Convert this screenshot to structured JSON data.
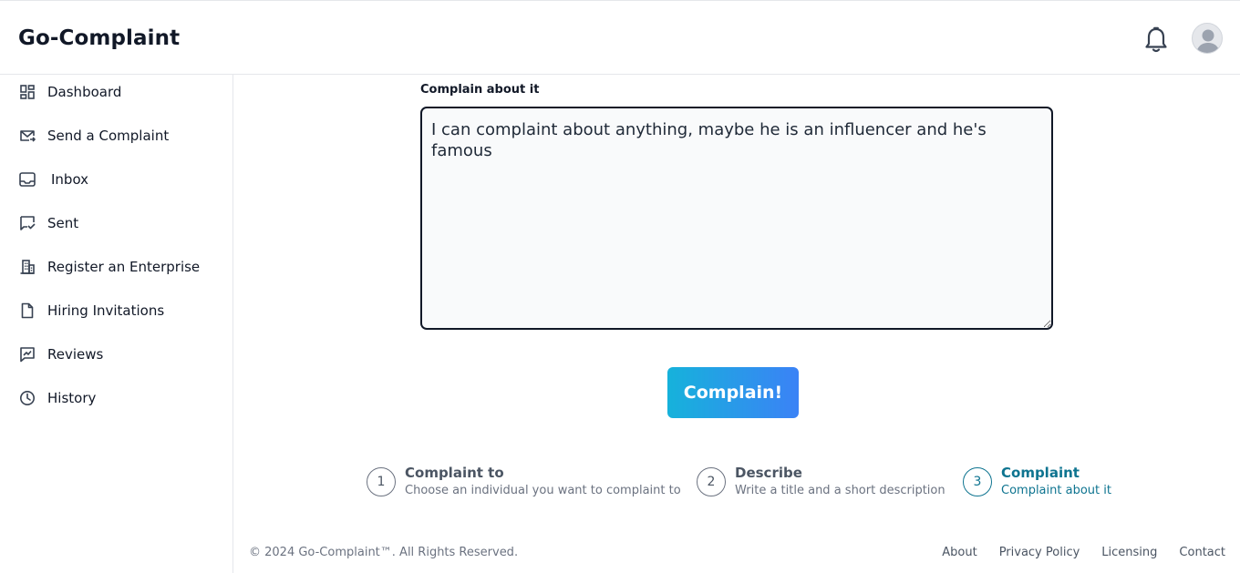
{
  "header": {
    "brand": "Go-Complaint",
    "notifications_icon": "bell-icon",
    "avatar_icon": "user-avatar-icon"
  },
  "sidebar": {
    "items": [
      {
        "label": "Dashboard",
        "icon": "dashboard-icon"
      },
      {
        "label": "Send a Complaint",
        "icon": "mail-send-icon"
      },
      {
        "label": "Inbox",
        "icon": "inbox-icon"
      },
      {
        "label": "Sent",
        "icon": "sent-icon"
      },
      {
        "label": "Register an Enterprise",
        "icon": "building-icon"
      },
      {
        "label": "Hiring Invitations",
        "icon": "document-icon"
      },
      {
        "label": "Reviews",
        "icon": "review-icon"
      },
      {
        "label": "History",
        "icon": "clock-icon"
      }
    ]
  },
  "form": {
    "label": "Complain about it",
    "text": "I can complaint about anything, maybe he is an influencer and he's famous",
    "submit_label": "Complain!"
  },
  "steps": [
    {
      "number": "1",
      "title": "Complaint to",
      "subtitle": "Choose an individual you want to complaint to",
      "active": false
    },
    {
      "number": "2",
      "title": "Describe",
      "subtitle": "Write a title and a short description",
      "active": false
    },
    {
      "number": "3",
      "title": "Complaint",
      "subtitle": "Complaint about it",
      "active": true
    }
  ],
  "footer": {
    "copyright": "© 2024 Go-Complaint™. All Rights Reserved.",
    "links": [
      "About",
      "Privacy Policy",
      "Licensing",
      "Contact"
    ]
  },
  "colors": {
    "accent": "#0e7490",
    "button_gradient_start": "#16b2db",
    "button_gradient_end": "#3b82f6"
  }
}
